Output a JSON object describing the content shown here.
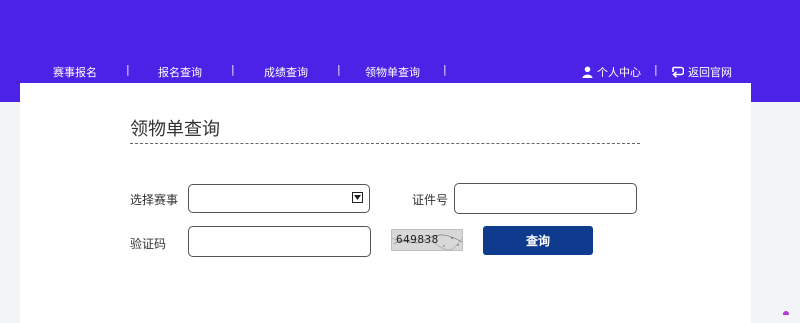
{
  "nav": {
    "items": [
      "赛事报名",
      "报名查询",
      "成绩查询",
      "领物单查询"
    ],
    "separator": "|",
    "personal_center": "个人中心",
    "back_home": "返回官网"
  },
  "page": {
    "title": "领物单查询"
  },
  "form": {
    "event_label": "选择赛事",
    "event_value": "",
    "id_label": "证件号",
    "id_value": "",
    "captcha_label": "验证码",
    "captcha_value": "",
    "captcha_text": "649838",
    "submit_label": "查询"
  },
  "colors": {
    "header_bg": "#4b22e6",
    "button_bg": "#0f3b8f"
  },
  "icons": [
    "user-icon",
    "return-icon",
    "dropdown-arrow-icon"
  ]
}
